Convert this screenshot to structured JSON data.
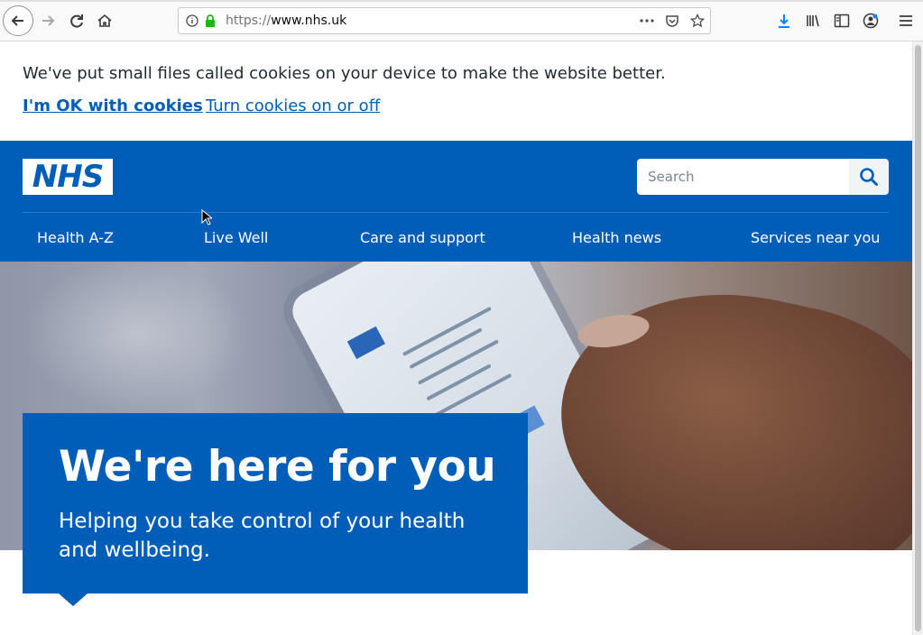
{
  "browser": {
    "url_scheme": "https://",
    "url_host": "www.nhs.uk",
    "icons": [
      "back-icon",
      "forward-icon",
      "reload-icon",
      "home-icon",
      "info-icon",
      "lock-icon",
      "page-actions-icon",
      "pocket-icon",
      "bookmark-star-icon",
      "downloads-icon",
      "library-icon",
      "sidebar-icon",
      "account-icon",
      "menu-icon"
    ]
  },
  "cookie_banner": {
    "message": "We've put small files called cookies on your device to make the website better.",
    "accept_link": "I'm OK with cookies",
    "settings_link": "Turn cookies on or off"
  },
  "header": {
    "logo_text": "NHS",
    "search_placeholder": "Search",
    "nav": [
      {
        "label": "Health A-Z"
      },
      {
        "label": "Live Well"
      },
      {
        "label": "Care and support"
      },
      {
        "label": "Health news"
      },
      {
        "label": "Services near you"
      }
    ]
  },
  "hero": {
    "title": "We're here for you",
    "subtitle": "Helping you take control of your health and wellbeing."
  },
  "colors": {
    "nhs_blue": "#005eb8",
    "link": "#005eb8",
    "text": "#212b32"
  }
}
